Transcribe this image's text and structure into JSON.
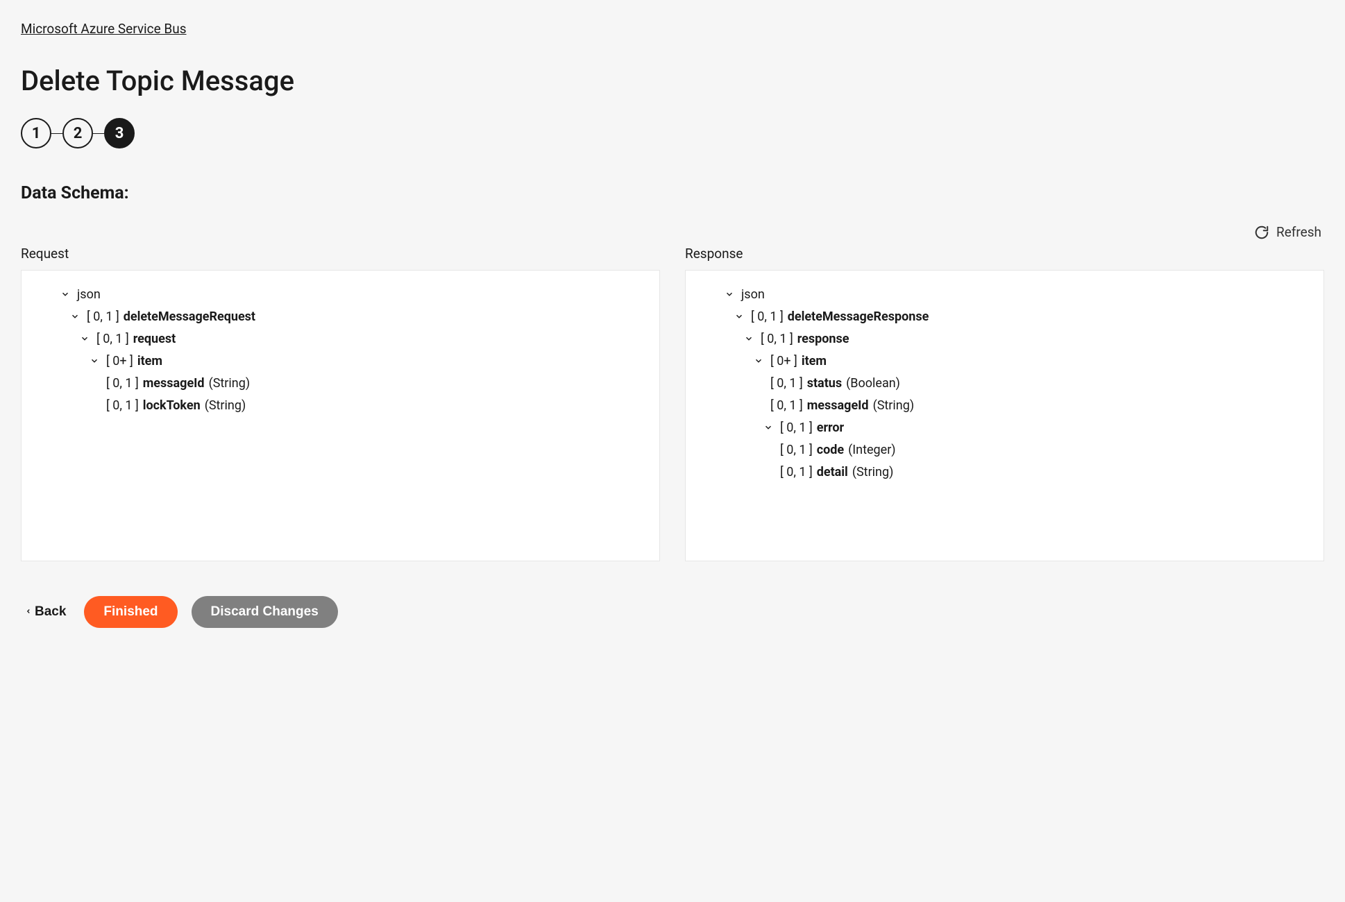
{
  "breadcrumb": {
    "label": "Microsoft Azure Service Bus"
  },
  "page_title": "Delete Topic Message",
  "stepper": {
    "steps": [
      "1",
      "2",
      "3"
    ],
    "active_index": 2
  },
  "section_title": "Data Schema:",
  "refresh": {
    "label": "Refresh"
  },
  "columns": {
    "request": {
      "label": "Request"
    },
    "response": {
      "label": "Response"
    }
  },
  "request_tree": {
    "root": {
      "label": "json"
    },
    "n1": {
      "cardinality": "[ 0, 1 ]",
      "name": "deleteMessageRequest"
    },
    "n2": {
      "cardinality": "[ 0, 1 ]",
      "name": "request"
    },
    "n3": {
      "cardinality": "[ 0+ ]",
      "name": "item"
    },
    "n4": {
      "cardinality": "[ 0, 1 ]",
      "name": "messageId",
      "type": "(String)"
    },
    "n5": {
      "cardinality": "[ 0, 1 ]",
      "name": "lockToken",
      "type": "(String)"
    }
  },
  "response_tree": {
    "root": {
      "label": "json"
    },
    "n1": {
      "cardinality": "[ 0, 1 ]",
      "name": "deleteMessageResponse"
    },
    "n2": {
      "cardinality": "[ 0, 1 ]",
      "name": "response"
    },
    "n3": {
      "cardinality": "[ 0+ ]",
      "name": "item"
    },
    "n4": {
      "cardinality": "[ 0, 1 ]",
      "name": "status",
      "type": "(Boolean)"
    },
    "n5": {
      "cardinality": "[ 0, 1 ]",
      "name": "messageId",
      "type": "(String)"
    },
    "n6": {
      "cardinality": "[ 0, 1 ]",
      "name": "error"
    },
    "n7": {
      "cardinality": "[ 0, 1 ]",
      "name": "code",
      "type": "(Integer)"
    },
    "n8": {
      "cardinality": "[ 0, 1 ]",
      "name": "detail",
      "type": "(String)"
    }
  },
  "footer": {
    "back": "Back",
    "finished": "Finished",
    "discard": "Discard Changes"
  }
}
